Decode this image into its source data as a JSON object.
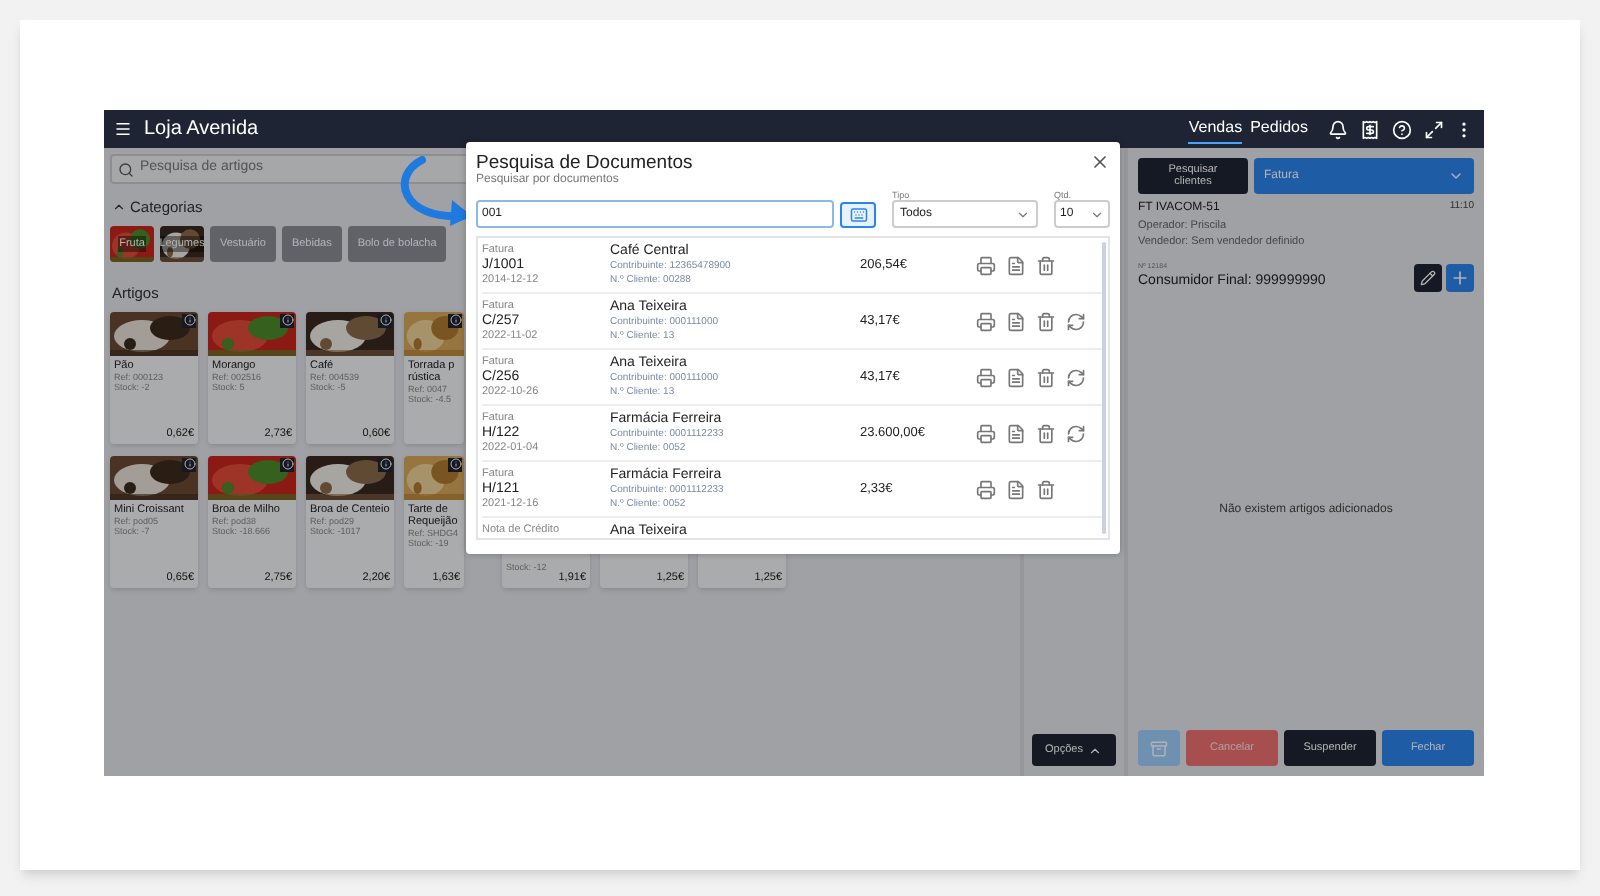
{
  "app": {
    "title": "Loja Avenida",
    "nav": [
      {
        "label": "Vendas",
        "selected": true
      },
      {
        "label": "Pedidos",
        "selected": false
      }
    ]
  },
  "articles": {
    "search_placeholder": "Pesquisa de artigos",
    "categories_title": "Categorias",
    "categories_expanded": true,
    "categories": [
      {
        "label": "Fruta",
        "kind": "picture"
      },
      {
        "label": "Legumes",
        "kind": "picture"
      },
      {
        "label": "Vestuário",
        "kind": "plain"
      },
      {
        "label": "Bebidas",
        "kind": "plain"
      },
      {
        "label": "Bolo de bolacha",
        "kind": "plain"
      }
    ],
    "title": "Artigos",
    "rows": [
      [
        {
          "name": "Pão",
          "ref": "Ref: 000123",
          "stock": "Stock: -2",
          "price": "0,62€"
        },
        {
          "name": "Morango",
          "ref": "Ref: 002516",
          "stock": "Stock: 5",
          "price": "2,73€"
        },
        {
          "name": "Café",
          "ref": "Ref: 004539",
          "stock": "Stock: -5",
          "price": "0,60€"
        },
        {
          "name": "Torrada p rústica",
          "ref": "Ref: 0047",
          "stock": "Stock: -4.5"
        }
      ],
      [
        {
          "name": "Mini Croissant",
          "ref": "Ref: pod05",
          "stock": "Stock: -7",
          "price": "0,65€"
        },
        {
          "name": "Broa de Milho",
          "ref": "Ref: pod38",
          "stock": "Stock: -18.666",
          "price": "2,75€"
        },
        {
          "name": "Broa de Centeio",
          "ref": "Ref: pod29",
          "stock": "Stock: -1017",
          "price": "2,20€"
        },
        {
          "name": "Tarte de Requeijão",
          "ref": "Ref: SHDG4",
          "stock": "Stock: -19",
          "price": "1,63€"
        },
        {
          "stock": "Stock: -12",
          "price": "1,91€"
        },
        {
          "price": "1,25€"
        },
        {
          "price": "1,25€"
        }
      ]
    ]
  },
  "options_button": "Opções",
  "cart": {
    "search_clients": "Pesquisar clientes",
    "doc_type": "Fatura",
    "doc": "FT IVACOM-51",
    "time": "11:10",
    "operator": "Operador: Priscila",
    "seller": "Vendedor: Sem vendedor definido",
    "number": "Nº 12184",
    "customer": "Consumidor Final: 999999990",
    "empty": "Não existem artigos adicionados",
    "actions": [
      {
        "label": "Cancelar",
        "kind": "danger"
      },
      {
        "label": "Suspender",
        "kind": "dark"
      },
      {
        "label": "Fechar",
        "kind": "primary"
      }
    ]
  },
  "modal": {
    "title": "Pesquisa de Documentos",
    "subtitle": "Pesquisar por documentos",
    "search_value": "001",
    "type_label": "Tipo",
    "type_value": "Todos",
    "qty_label": "Qtd.",
    "qty_value": "10",
    "rows": [
      {
        "type": "Fatura",
        "number": "J/1001",
        "date": "2014-12-12",
        "name": "Café Central",
        "taxpayer": "Contribuinte: 12365478900",
        "client": "N.º Cliente: 00288",
        "amount": "206,54€",
        "convert": false
      },
      {
        "type": "Fatura",
        "number": "C/257",
        "date": "2022-11-02",
        "name": "Ana Teixeira",
        "taxpayer": "Contribuinte: 000111000",
        "client": "N.º Cliente: 13",
        "amount": "43,17€",
        "convert": true
      },
      {
        "type": "Fatura",
        "number": "C/256",
        "date": "2022-10-26",
        "name": "Ana Teixeira",
        "taxpayer": "Contribuinte: 000111000",
        "client": "N.º Cliente: 13",
        "amount": "43,17€",
        "convert": true
      },
      {
        "type": "Fatura",
        "number": "H/122",
        "date": "2022-01-04",
        "name": "Farmácia Ferreira",
        "taxpayer": "Contribuinte: 0001112233",
        "client": "N.º Cliente: 0052",
        "amount": "23.600,00€",
        "convert": true
      },
      {
        "type": "Fatura",
        "number": "H/121",
        "date": "2021-12-16",
        "name": "Farmácia Ferreira",
        "taxpayer": "Contribuinte: 0001112233",
        "client": "N.º Cliente: 0052",
        "amount": "2,33€",
        "convert": false
      },
      {
        "type": "Nota de Crédito",
        "name": "Ana Teixeira"
      }
    ]
  }
}
